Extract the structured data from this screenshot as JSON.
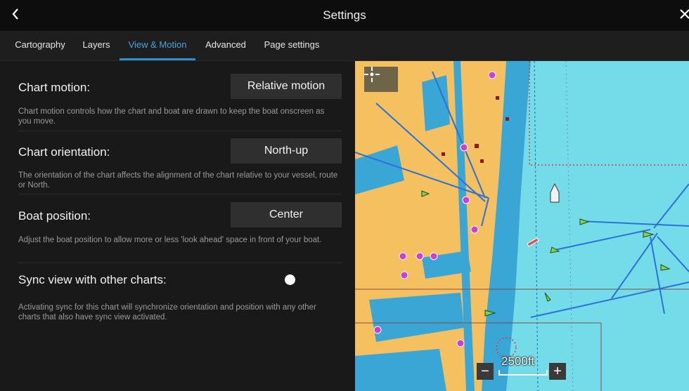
{
  "header": {
    "title": "Settings",
    "back_icon": "chevron-left-icon",
    "close_icon": "close-icon"
  },
  "tabs": [
    {
      "label": "Cartography",
      "active": false
    },
    {
      "label": "Layers",
      "active": false
    },
    {
      "label": "View & Motion",
      "active": true
    },
    {
      "label": "Advanced",
      "active": false
    },
    {
      "label": "Page settings",
      "active": false
    }
  ],
  "settings": {
    "chart_motion": {
      "label": "Chart motion:",
      "value": "Relative motion",
      "description": "Chart motion controls how the chart and boat are drawn to keep the boat onscreen as you move."
    },
    "chart_orientation": {
      "label": "Chart orientation:",
      "value": "North-up",
      "description": "The orientation of the chart affects the alignment of the chart relative to your vessel, route or North."
    },
    "boat_position": {
      "label": "Boat position:",
      "value": "Center",
      "description": "Adjust the boat position to allow more or less 'look ahead' space in front of your boat."
    },
    "sync_view": {
      "label": "Sync view with other charts:",
      "enabled": true,
      "description": "Activating sync for this chart will synchronize orientation and position with any other charts that also have sync view activated."
    }
  },
  "map": {
    "scale": "2500ft",
    "zoom_in": "+",
    "zoom_out": "−",
    "locate_icon": "crosshair-icon",
    "colors": {
      "land": "#f4c060",
      "shallow": "#3aa6d6",
      "deep": "#74dce8",
      "route": "#2f6fd8",
      "marker": "#d63ad6"
    }
  }
}
